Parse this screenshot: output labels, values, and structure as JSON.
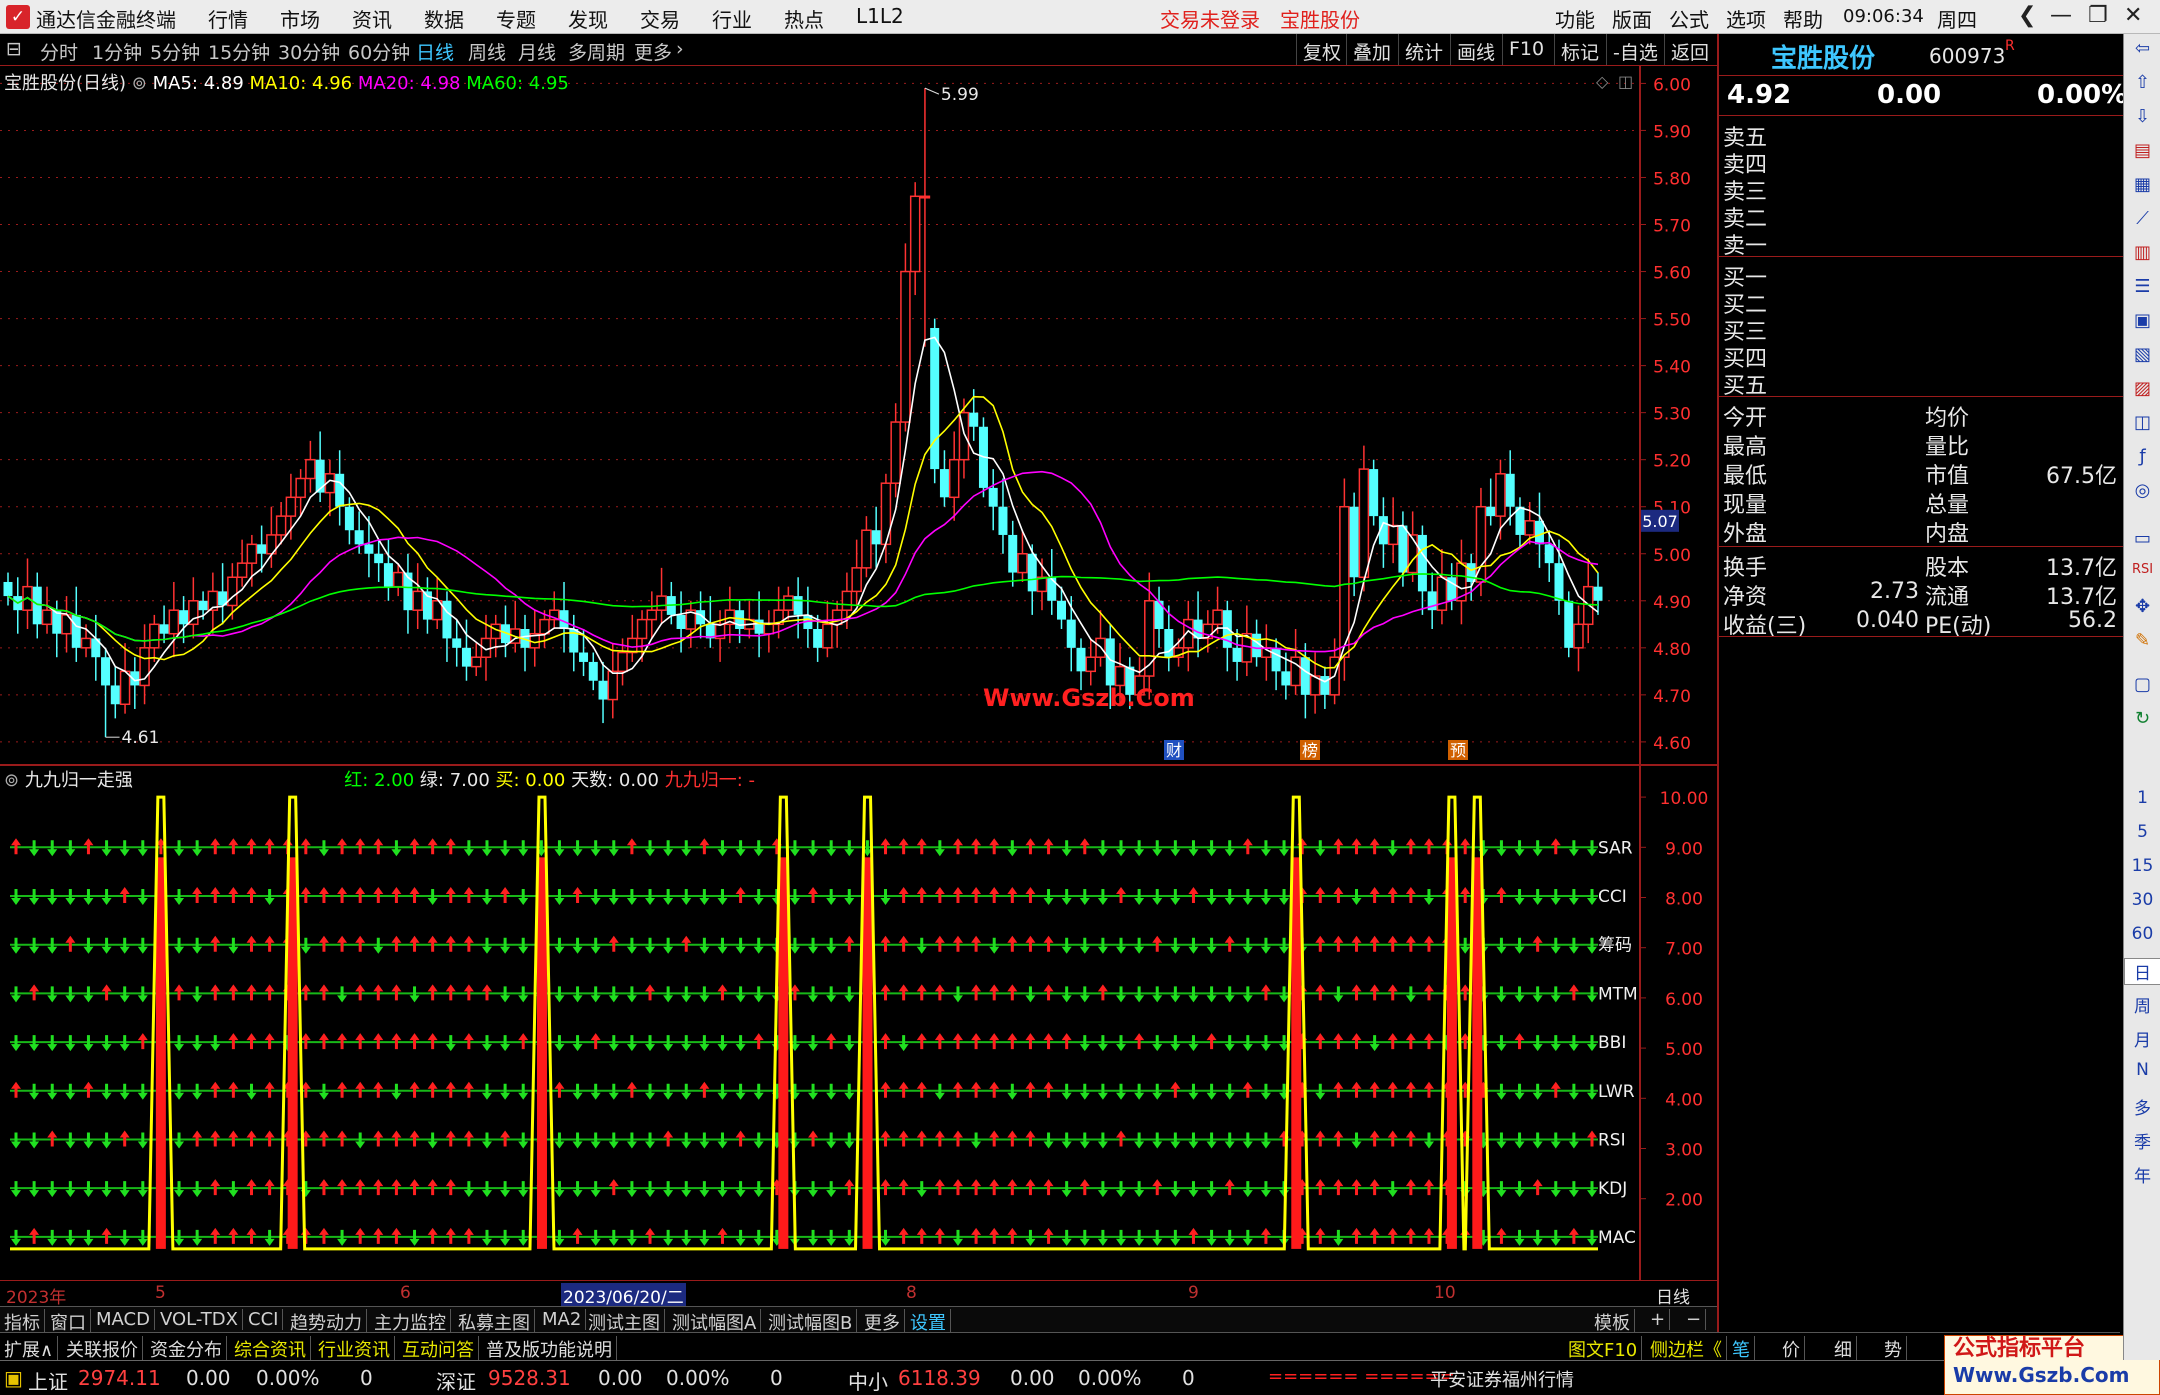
{
  "app": {
    "title": "通达信金融终端",
    "menus": [
      "行情",
      "市场",
      "资讯",
      "数据",
      "专题",
      "发现",
      "交易",
      "行业",
      "热点",
      "L1L2"
    ],
    "login_status": "交易未登录",
    "stock_title": "宝胜股份",
    "right_menus": [
      "功能",
      "版面",
      "公式",
      "选项",
      "帮助"
    ],
    "time": "09:06:34",
    "weekday": "周四"
  },
  "periods": {
    "items": [
      "分时",
      "1分钟",
      "5分钟",
      "15分钟",
      "30分钟",
      "60分钟",
      "日线",
      "周线",
      "月线",
      "多周期",
      "更多"
    ],
    "active": "日线",
    "tools": [
      "复权",
      "叠加",
      "统计",
      "画线",
      "F10",
      "标记",
      "-自选",
      "返回"
    ]
  },
  "main_legend": {
    "title": "宝胜股份(日线)",
    "ma5": "MA5: 4.89",
    "ma10": "MA10: 4.96",
    "ma20": "MA20: 4.98",
    "ma60": "MA60: 4.95"
  },
  "sub_legend": {
    "title": "九九归一走强",
    "red": "红: 2.00",
    "green": "绿: 7.00",
    "buy": "买: 0.00",
    "days": "天数: 0.00",
    "name2": "九九归一: -"
  },
  "watermark": "Www.Gszb.Com",
  "annotations": {
    "high": "5.99",
    "low": "4.61",
    "marker_cai": "财",
    "marker_bang": "榜",
    "marker_yu": "预",
    "current_price_tag": "5.07"
  },
  "colors": {
    "up": "#ff3232",
    "down": "#54ffff",
    "ma5": "#ffffff",
    "ma10": "#ffff00",
    "ma20": "#ff00ff",
    "ma60": "#00ff00",
    "arrow_up": "#ff2020",
    "arrow_down": "#20e020",
    "yellow": "#ffff00",
    "grid": "#9a1b1b"
  },
  "chart_data": [
    {
      "type": "candlestick",
      "title": "宝胜股份(日线)",
      "y_ticks": [
        "6.00",
        "5.90",
        "5.80",
        "5.70",
        "5.60",
        "5.50",
        "5.40",
        "5.30",
        "5.20",
        "5.10",
        "5.00",
        "4.90",
        "4.80",
        "4.70",
        "4.60"
      ],
      "ylim": [
        4.57,
        6.02
      ],
      "close": [
        4.91,
        4.88,
        4.93,
        4.85,
        4.88,
        4.83,
        4.87,
        4.8,
        4.82,
        4.78,
        4.72,
        4.68,
        4.75,
        4.72,
        4.8,
        4.85,
        4.83,
        4.88,
        4.85,
        4.9,
        4.88,
        4.92,
        4.89,
        4.95,
        4.98,
        5.02,
        5.0,
        5.04,
        5.08,
        5.12,
        5.16,
        5.2,
        5.13,
        5.17,
        5.1,
        5.05,
        5.02,
        5.0,
        4.98,
        4.93,
        4.96,
        4.88,
        4.92,
        4.86,
        4.9,
        4.82,
        4.8,
        4.76,
        4.78,
        4.82,
        4.85,
        4.81,
        4.84,
        4.8,
        4.83,
        4.86,
        4.88,
        4.84,
        4.79,
        4.77,
        4.73,
        4.69,
        4.75,
        4.79,
        4.82,
        4.86,
        4.88,
        4.91,
        4.87,
        4.84,
        4.88,
        4.85,
        4.82,
        4.85,
        4.88,
        4.84,
        4.86,
        4.83,
        4.85,
        4.88,
        4.91,
        4.87,
        4.84,
        4.8,
        4.85,
        4.88,
        4.92,
        4.97,
        5.05,
        5.02,
        5.15,
        5.28,
        5.6,
        5.76,
        5.48,
        5.18,
        5.12,
        5.2,
        5.3,
        5.27,
        5.14,
        5.1,
        5.04,
        4.96,
        5.0,
        4.92,
        4.95,
        4.9,
        4.86,
        4.8,
        4.75,
        4.78,
        4.82,
        4.72,
        4.76,
        4.7,
        4.74,
        4.9,
        4.84,
        4.78,
        4.8,
        4.86,
        4.82,
        4.85,
        4.88,
        4.8,
        4.77,
        4.83,
        4.78,
        4.8,
        4.75,
        4.72,
        4.78,
        4.7,
        4.74,
        4.7,
        4.78,
        5.1,
        4.95,
        5.18,
        5.08,
        5.02,
        5.06,
        4.96,
        5.04,
        4.92,
        4.88,
        4.95,
        4.9,
        4.98,
        4.94,
        5.1,
        5.08,
        5.17,
        5.1,
        5.04,
        5.07,
        5.02,
        4.98,
        4.9,
        4.8,
        4.85,
        4.93,
        4.9
      ],
      "series": [
        {
          "name": "MA5",
          "last": 4.89
        },
        {
          "name": "MA10",
          "last": 4.96
        },
        {
          "name": "MA20",
          "last": 4.98
        },
        {
          "name": "MA60",
          "last": 4.95
        }
      ]
    },
    {
      "type": "line",
      "title": "九九归一走强",
      "y_ticks": [
        "10.00",
        "9.00",
        "8.00",
        "7.00",
        "6.00",
        "5.00",
        "4.00",
        "3.00",
        "2.00"
      ],
      "ylim": [
        0.5,
        10.5
      ],
      "row_labels": [
        "SAR",
        "CCI",
        "筹码",
        "MTM",
        "BBI",
        "LWR",
        "RSI",
        "KDJ",
        "MAC"
      ],
      "spike_positions": [
        0.095,
        0.178,
        0.335,
        0.487,
        0.54,
        0.81,
        0.908,
        0.924
      ],
      "spike_value": 10.0
    }
  ],
  "xaxis": {
    "labels": [
      "2023年",
      "5",
      "6",
      "2023/06/20/二",
      "8",
      "9",
      "10"
    ],
    "right_label": "日线"
  },
  "tabs1": [
    "指标",
    "窗口",
    "MACD",
    "VOL-TDX",
    "CCI",
    "趋势动力",
    "主力监控",
    "私募主图",
    "MA2",
    "测试主图",
    "测试幅图A",
    "测试幅图B",
    "更多",
    "设置"
  ],
  "tabs1_right": [
    "模板",
    "+",
    "−"
  ],
  "tabs2": [
    "扩展∧",
    "关联报价",
    "资金分布",
    "综合资讯",
    "行业资讯",
    "互动问答",
    "普及版功能说明"
  ],
  "tabs2_right": [
    "图文F10",
    "侧边栏《",
    "笔",
    "价",
    "细",
    "势"
  ],
  "quote": {
    "name": "宝胜股份",
    "code": "600973",
    "r": "R",
    "price": "4.92",
    "change": "0.00",
    "pct": "0.00%",
    "sell": [
      "卖五",
      "卖四",
      "卖三",
      "卖二",
      "卖一"
    ],
    "buy": [
      "买一",
      "买二",
      "买三",
      "买四",
      "买五"
    ],
    "info": [
      [
        "今开",
        "",
        "均价",
        ""
      ],
      [
        "最高",
        "",
        "量比",
        ""
      ],
      [
        "最低",
        "",
        "市值",
        "67.5亿"
      ],
      [
        "现量",
        "",
        "总量",
        ""
      ],
      [
        "外盘",
        "",
        "内盘",
        ""
      ]
    ],
    "info2": [
      [
        "换手",
        "",
        "股本",
        "13.7亿"
      ],
      [
        "净资",
        "2.73",
        "流通",
        "13.7亿"
      ],
      [
        "收益(三)",
        "0.040",
        "PE(动)",
        "56.2"
      ]
    ]
  },
  "sidebar": [
    "1",
    "5",
    "15",
    "30",
    "60",
    "日",
    "周",
    "月",
    "N",
    "多",
    "季",
    "年"
  ],
  "status": {
    "sh_name": "上证",
    "sh_val": "2974.11",
    "sh_chg": "0.00",
    "sh_pct": "0.00%",
    "sh_vol": "0",
    "sz_name": "深证",
    "sz_val": "9528.31",
    "sz_chg": "0.00",
    "sz_pct": "0.00%",
    "sz_vol": "0",
    "zx_name": "中小",
    "zx_val": "6118.39",
    "zx_chg": "0.00",
    "zx_pct": "0.00%",
    "zx_vol": "0",
    "dashes": "====== ======",
    "broker": "平安证券福州行情",
    "badge1": "公式指标平台",
    "badge2": "Www.Gszb.Com"
  }
}
